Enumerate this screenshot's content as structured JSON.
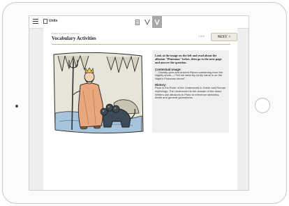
{
  "app": {
    "units_label": "Units",
    "toolbar": {
      "tools": [
        "notes-icon",
        "glossary-icon",
        "vocabulary-icon"
      ],
      "active_tool": "vocabulary-icon"
    }
  },
  "page": {
    "breadcrumb": "Future Vocabulary Activities",
    "title": "Vocabulary Activities",
    "pager": "1 of 4",
    "next_label": "NEXT",
    "next_arrow": ">"
  },
  "info": {
    "prompt": "Look at the image on the left and read about the allusion \"Plutonian\" below, then go to the next page and answer the question.",
    "usage_heading": "Contextual Usage:",
    "usage_text": "\"...Ghastly grim and ancient Raven wandering from the Nightly shore—/ Tell me what thy lordly name is on the Night's Plutonian shore!\"",
    "history_heading": "History:",
    "history_text": "Pluto is the Ruler of the Underworld in Greek and Roman mythology. The Underworld is the domain of the dead. Writers use allusions to Pluto to reference darkness, death and general gloominess."
  },
  "colors": {
    "accent": "#c8b88a",
    "active_tool": "#a6aaa6",
    "info_bg": "#efefef"
  }
}
